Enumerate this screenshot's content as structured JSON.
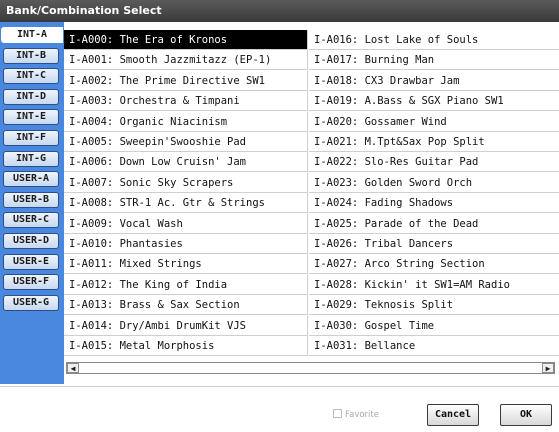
{
  "dialog": {
    "title": "Bank/Combination Select"
  },
  "tabs": [
    "INT-A",
    "INT-B",
    "INT-C",
    "INT-D",
    "INT-E",
    "INT-F",
    "INT-G",
    "USER-A",
    "USER-B",
    "USER-C",
    "USER-D",
    "USER-E",
    "USER-F",
    "USER-G"
  ],
  "active_tab": "INT-A",
  "items_left": [
    "I-A000: The Era of Kronos",
    "I-A001: Smooth Jazzmitazz (EP-1)",
    "I-A002: The Prime Directive SW1",
    "I-A003: Orchestra & Timpani",
    "I-A004: Organic Niacinism",
    "I-A005: Sweepin'Swooshie Pad",
    "I-A006: Down Low Cruisn' Jam",
    "I-A007: Sonic Sky Scrapers",
    "I-A008: STR-1 Ac. Gtr & Strings",
    "I-A009: Vocal Wash",
    "I-A010: Phantasies",
    "I-A011: Mixed Strings",
    "I-A012: The King of India",
    "I-A013: Brass & Sax Section",
    "I-A014: Dry/Ambi DrumKit VJS",
    "I-A015: Metal Morphosis"
  ],
  "items_right": [
    "I-A016: Lost Lake of Souls",
    "I-A017: Burning Man",
    "I-A018: CX3 Drawbar Jam",
    "I-A019: A.Bass & SGX Piano SW1",
    "I-A020: Gossamer Wind",
    "I-A021: M.Tpt&Sax Pop Split",
    "I-A022: Slo-Res Guitar Pad",
    "I-A023: Golden Sword Orch",
    "I-A024: Fading Shadows",
    "I-A025: Parade of the Dead",
    "I-A026: Tribal Dancers",
    "I-A027: Arco String Section",
    "I-A028: Kickin' it  SW1=AM Radio",
    "I-A029: Teknosis Split",
    "I-A030: Gospel Time",
    "I-A031: Bellance"
  ],
  "selected_item": "I-A000: The Era of Kronos",
  "scrollbar": {
    "left_arrow": "◀",
    "right_arrow": "▶"
  },
  "footer": {
    "favorite_label": "Favorite",
    "cancel_label": "Cancel",
    "ok_label": "OK"
  },
  "colors": {
    "sidebar": "#4a87df",
    "titlebar": "#4a4a4a",
    "selected_bg": "#000000"
  }
}
